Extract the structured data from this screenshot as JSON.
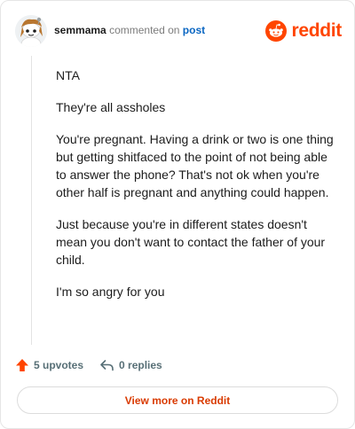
{
  "header": {
    "author": "semmama",
    "action_text": "commented on",
    "post_link": "post",
    "brand": "reddit",
    "avatar_icon": "snoo-avatar-icon",
    "brand_icon": "reddit-logo-icon"
  },
  "comment": {
    "paragraphs": [
      "NTA",
      "They're all assholes",
      "You're pregnant. Having a drink or two is one thing but getting shitfaced to the point of not being able to answer the phone? That's not ok when you're other half is pregnant and anything could happen.",
      "Just because you're in different states doesn't mean you don't want to contact the father of your child.",
      "I'm so angry for you"
    ]
  },
  "actions": {
    "upvotes": "5 upvotes",
    "replies": "0 replies"
  },
  "view_more": "View more on Reddit",
  "colors": {
    "brand": "#ff4500",
    "link": "#0a66c2",
    "view_more_text": "#d93a00",
    "muted": "#576f76"
  }
}
